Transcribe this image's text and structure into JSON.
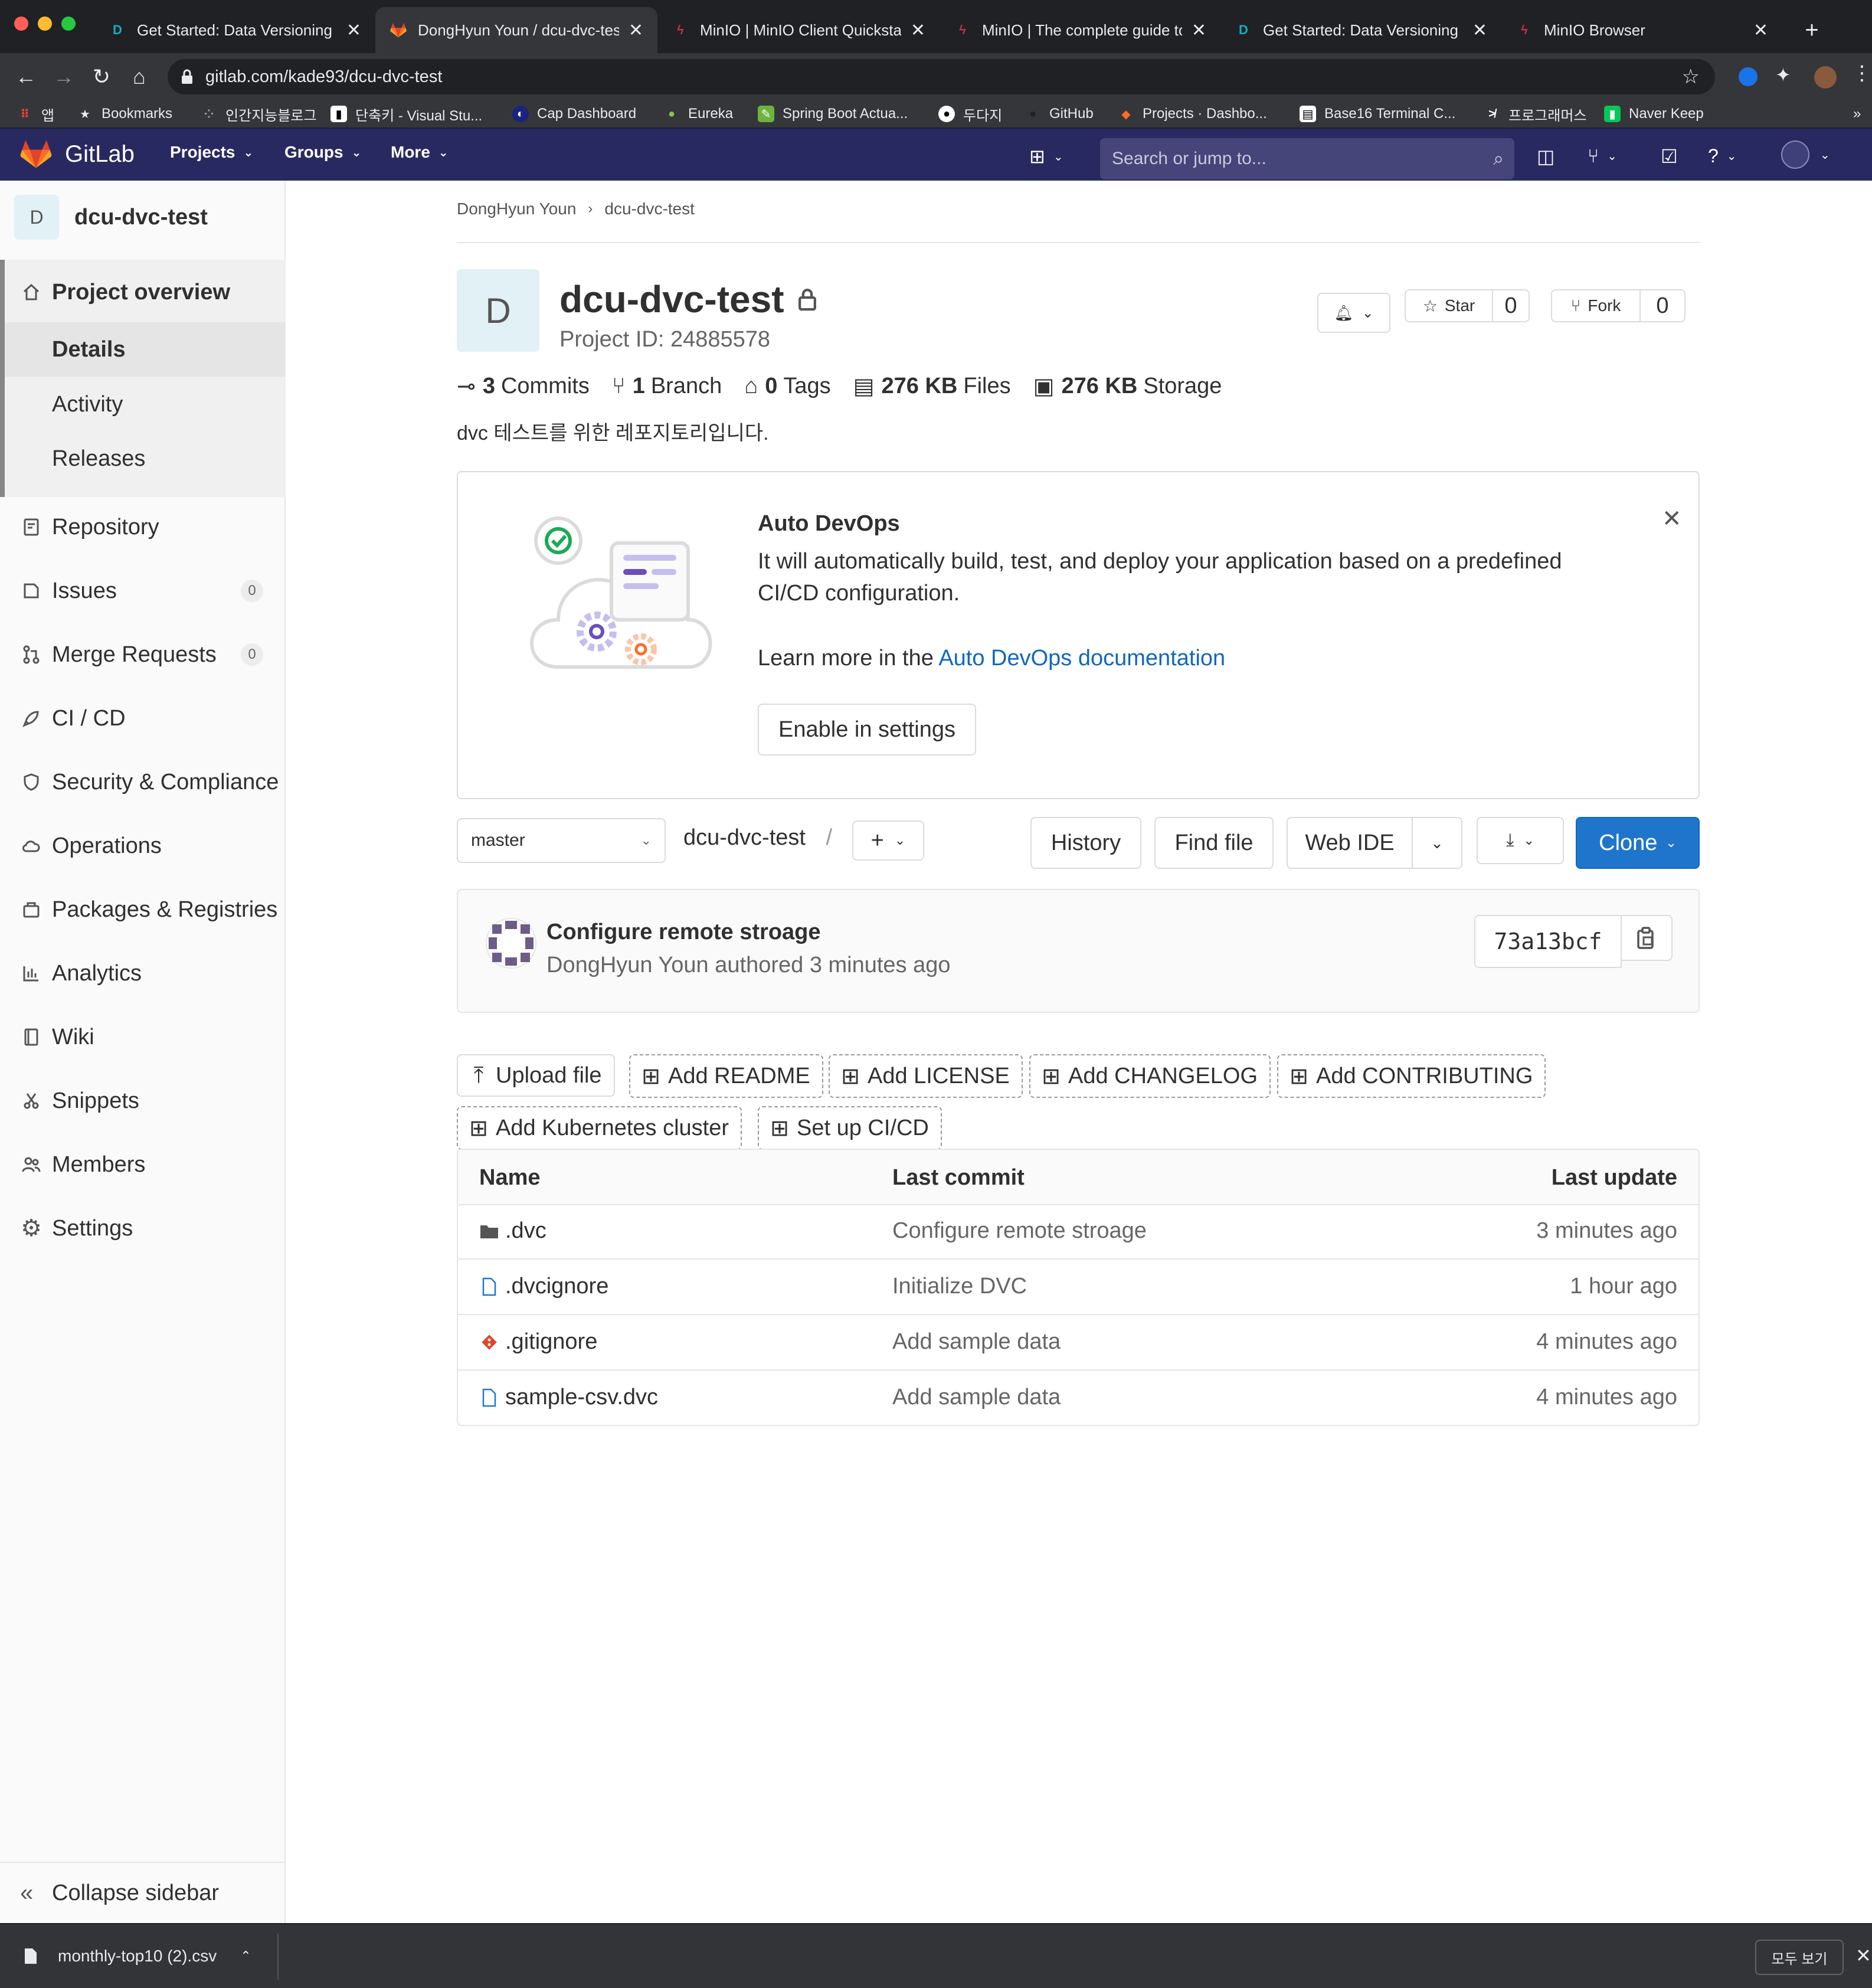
{
  "browser": {
    "tabs": [
      {
        "label": "Get Started: Data Versioning | D",
        "icon": "dvc-icon"
      },
      {
        "label": "DongHyun Youn / dcu-dvc-test",
        "icon": "gitlab-icon",
        "active": true
      },
      {
        "label": "MinIO | MinIO Client Quickstart",
        "icon": "minio-icon"
      },
      {
        "label": "MinIO | The complete guide to",
        "icon": "minio-icon"
      },
      {
        "label": "Get Started: Data Versioning | D",
        "icon": "dvc-icon"
      },
      {
        "label": "MinIO Browser",
        "icon": "minio-icon"
      }
    ],
    "url": "gitlab.com/kade93/dcu-dvc-test",
    "bookmarks": [
      {
        "label": "앱",
        "icon": "apps-grid-icon"
      },
      {
        "label": "Bookmarks",
        "icon": "star-icon"
      },
      {
        "label": "인간지능블로그",
        "icon": "blog-icon"
      },
      {
        "label": "단축키 - Visual Stu...",
        "icon": "vscode-icon"
      },
      {
        "label": "Cap Dashboard",
        "icon": "cap-icon"
      },
      {
        "label": "Eureka",
        "icon": "eureka-icon"
      },
      {
        "label": "Spring Boot Actua...",
        "icon": "spring-icon"
      },
      {
        "label": "두다지",
        "icon": "dudaji-icon"
      },
      {
        "label": "GitHub",
        "icon": "github-icon"
      },
      {
        "label": "Projects · Dashbo...",
        "icon": "gitlab-icon"
      },
      {
        "label": "Base16 Terminal C...",
        "icon": "base16-icon"
      },
      {
        "label": "프로그래머스",
        "icon": "programmers-icon"
      },
      {
        "label": "Naver Keep",
        "icon": "keep-icon"
      }
    ]
  },
  "gitlab": {
    "brand": "GitLab",
    "nav": [
      "Projects",
      "Groups",
      "More"
    ],
    "search_placeholder": "Search or jump to..."
  },
  "sidebar": {
    "project_initial": "D",
    "project_name": "dcu-dvc-test",
    "overview": "Project overview",
    "overview_children": [
      "Details",
      "Activity",
      "Releases"
    ],
    "items": [
      {
        "label": "Repository",
        "icon": "repository-icon"
      },
      {
        "label": "Issues",
        "icon": "issues-icon",
        "count": "0"
      },
      {
        "label": "Merge Requests",
        "icon": "merge-request-icon",
        "count": "0"
      },
      {
        "label": "CI / CD",
        "icon": "rocket-icon"
      },
      {
        "label": "Security & Compliance",
        "icon": "shield-icon"
      },
      {
        "label": "Operations",
        "icon": "cloud-gear-icon"
      },
      {
        "label": "Packages & Registries",
        "icon": "package-icon"
      },
      {
        "label": "Analytics",
        "icon": "chart-icon"
      },
      {
        "label": "Wiki",
        "icon": "book-icon"
      },
      {
        "label": "Snippets",
        "icon": "snippet-icon"
      },
      {
        "label": "Members",
        "icon": "users-icon"
      },
      {
        "label": "Settings",
        "icon": "gear-icon"
      }
    ],
    "collapse": "Collapse sidebar"
  },
  "project": {
    "breadcrumb": [
      "DongHyun Youn",
      "dcu-dvc-test"
    ],
    "initial": "D",
    "title": "dcu-dvc-test",
    "id_text": "Project ID: 24885578",
    "star_label": "Star",
    "star_count": "0",
    "fork_label": "Fork",
    "fork_count": "0",
    "stats": {
      "commits_num": "3",
      "commits_label": "Commits",
      "branch_num": "1",
      "branch_label": "Branch",
      "tags_num": "0",
      "tags_label": "Tags",
      "files_num": "276 KB",
      "files_label": "Files",
      "storage_num": "276 KB",
      "storage_label": "Storage"
    },
    "description": "dvc 테스트를 위한 레포지토리입니다."
  },
  "devops": {
    "title": "Auto DevOps",
    "body": "It will automatically build, test, and deploy your application based on a predefined CI/CD configuration.",
    "learn_prefix": "Learn more in the",
    "learn_link": "Auto DevOps documentation",
    "button": "Enable in settings"
  },
  "toolbar": {
    "branch": "master",
    "path": "dcu-dvc-test",
    "sep": "/",
    "history": "History",
    "find_file": "Find file",
    "web_ide": "Web IDE",
    "clone": "Clone"
  },
  "commit": {
    "title": "Configure remote stroage",
    "author_line": "DongHyun Youn authored 3 minutes ago",
    "sha": "73a13bcf"
  },
  "actions": [
    {
      "label": "Upload file",
      "style": "solid",
      "icon": "upload-icon"
    },
    {
      "label": "Add README",
      "style": "dashed",
      "icon": "plus-square-icon"
    },
    {
      "label": "Add LICENSE",
      "style": "dashed",
      "icon": "plus-square-icon"
    },
    {
      "label": "Add CHANGELOG",
      "style": "dashed",
      "icon": "plus-square-icon"
    },
    {
      "label": "Add CONTRIBUTING",
      "style": "dashed",
      "icon": "plus-square-icon"
    },
    {
      "label": "Add Kubernetes cluster",
      "style": "dashed",
      "icon": "plus-square-icon"
    },
    {
      "label": "Set up CI/CD",
      "style": "dashed",
      "icon": "plus-square-icon"
    }
  ],
  "files": {
    "headers": [
      "Name",
      "Last commit",
      "Last update"
    ],
    "rows": [
      {
        "name": ".dvc",
        "icon": "folder-icon",
        "commit": "Configure remote stroage",
        "updated": "3 minutes ago"
      },
      {
        "name": ".dvcignore",
        "icon": "file-icon",
        "commit": "Initialize DVC",
        "updated": "1 hour ago"
      },
      {
        "name": ".gitignore",
        "icon": "git-icon",
        "commit": "Add sample data",
        "updated": "4 minutes ago"
      },
      {
        "name": "sample-csv.dvc",
        "icon": "file-icon",
        "commit": "Add sample data",
        "updated": "4 minutes ago"
      }
    ]
  },
  "downloads": {
    "file": "monthly-top10 (2).csv",
    "show_all": "모두 보기"
  },
  "colors": {
    "gitlab_header": "#292961",
    "link": "#1068bf",
    "clone_button": "#1f75cb"
  }
}
